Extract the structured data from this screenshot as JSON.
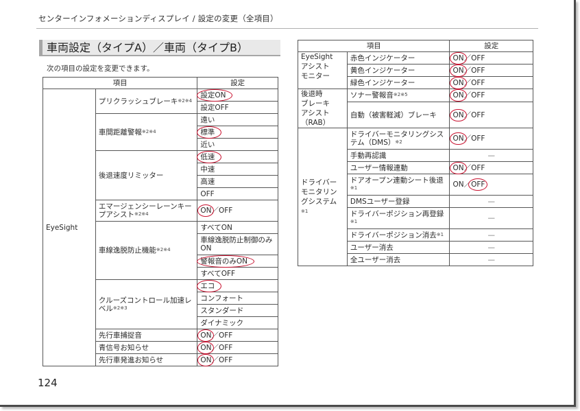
{
  "running_head": "センターインフォメーションディスプレイ / 設定の変更（全項目）",
  "section_title": "車両設定（タイプA）／車両（タイプB）",
  "intro_text": "次の項目の設定を変更できます。",
  "page_number": "124",
  "accent_color": "#c8102e",
  "left_table": {
    "headers": {
      "item": "項目",
      "setting": "設定"
    },
    "group": "EyeSight",
    "rows": [
      {
        "item": "プリクラッシュブレーキ",
        "note": "※2※4",
        "options": [
          {
            "label": "設定ON",
            "selected": true
          },
          {
            "label": "設定OFF",
            "selected": false
          }
        ]
      },
      {
        "item": "車間距離警報",
        "note": "※2※4",
        "options": [
          {
            "label": "遠い",
            "selected": false
          },
          {
            "label": "標準",
            "selected": true
          },
          {
            "label": "近い",
            "selected": false
          }
        ]
      },
      {
        "item": "後退速度リミッター",
        "note": "",
        "options": [
          {
            "label": "低速",
            "selected": true
          },
          {
            "label": "中速",
            "selected": false
          },
          {
            "label": "高速",
            "selected": false
          },
          {
            "label": "OFF",
            "selected": false
          }
        ]
      },
      {
        "item": "エマージェンシーレーンキープアシスト",
        "note": "※2※4",
        "on": "ON",
        "off": "OFF",
        "selected": "ON"
      },
      {
        "item": "車線逸脱防止機能",
        "note": "※2※4",
        "options": [
          {
            "label": "すべてON",
            "selected": false
          },
          {
            "label": "車線逸脱防止制御のみON",
            "selected": false
          },
          {
            "label": "警報音のみON",
            "selected": true
          },
          {
            "label": "すべてOFF",
            "selected": false
          }
        ]
      },
      {
        "item": "クルーズコントロール加速レベル",
        "note": "※2※3",
        "options": [
          {
            "label": "エコ",
            "selected": true
          },
          {
            "label": "コンフォート",
            "selected": false
          },
          {
            "label": "スタンダード",
            "selected": false
          },
          {
            "label": "ダイナミック",
            "selected": false
          }
        ]
      },
      {
        "item": "先行車捕捉音",
        "note": "",
        "on": "ON",
        "off": "OFF",
        "selected": "ON"
      },
      {
        "item": "青信号お知らせ",
        "note": "",
        "on": "ON",
        "off": "OFF",
        "selected": "ON"
      },
      {
        "item": "先行車発進お知らせ",
        "note": "",
        "on": "ON",
        "off": "OFF",
        "selected": "ON"
      }
    ]
  },
  "right_table": {
    "headers": {
      "item": "項目",
      "setting": "設定"
    },
    "groups": [
      {
        "name": "EyeSightアシストモニター",
        "name_lines": [
          "EyeSight",
          "アシスト",
          "モニター"
        ],
        "note": "",
        "rows": [
          {
            "item": "赤色インジケーター",
            "note": "",
            "on": "ON",
            "off": "OFF",
            "selected": "ON"
          },
          {
            "item": "黄色インジケーター",
            "note": "",
            "on": "ON",
            "off": "OFF",
            "selected": "ON"
          },
          {
            "item": "緑色インジケーター",
            "note": "",
            "on": "ON",
            "off": "OFF",
            "selected": "ON"
          }
        ]
      },
      {
        "name": "後退時ブレーキアシスト（RAB）",
        "name_lines": [
          "後退時",
          "ブレーキ",
          "アシスト",
          "（RAB）"
        ],
        "note": "",
        "rows": [
          {
            "item": "ソナー警報音",
            "note": "※2※5",
            "on": "ON",
            "off": "OFF",
            "selected": "ON"
          },
          {
            "item": "自動（被害軽減）ブレーキ",
            "note": "",
            "on": "ON",
            "off": "OFF",
            "selected": "ON"
          }
        ]
      },
      {
        "name": "ドライバーモニタリングシステム",
        "name_lines": [
          "ドライバー",
          "モニタリン",
          "グシステム"
        ],
        "note": "※1",
        "rows": [
          {
            "item": "ドライバーモニタリングシステム（DMS）",
            "note": "※2",
            "on": "ON",
            "off": "OFF",
            "selected": "ON"
          },
          {
            "item": "手動再認識",
            "note": "",
            "value": "—"
          },
          {
            "item": "ユーザー情報連動",
            "note": "",
            "on": "ON",
            "off": "OFF",
            "selected": "ON"
          },
          {
            "item": "ドアオープン連動シート後退",
            "note": "※1",
            "on": "ON",
            "off": "OFF",
            "selected": "OFF"
          },
          {
            "item": "DMSユーザー登録",
            "note": "",
            "value": "—"
          },
          {
            "item": "ドライバーポジション再登録",
            "note": "※1",
            "value": "—"
          },
          {
            "item": "ドライバーポジション消去",
            "note": "※1",
            "value": "—"
          },
          {
            "item": "ユーザー消去",
            "note": "",
            "value": "—"
          },
          {
            "item": "全ユーザー消去",
            "note": "",
            "value": "—"
          }
        ]
      }
    ]
  },
  "separator": "／"
}
